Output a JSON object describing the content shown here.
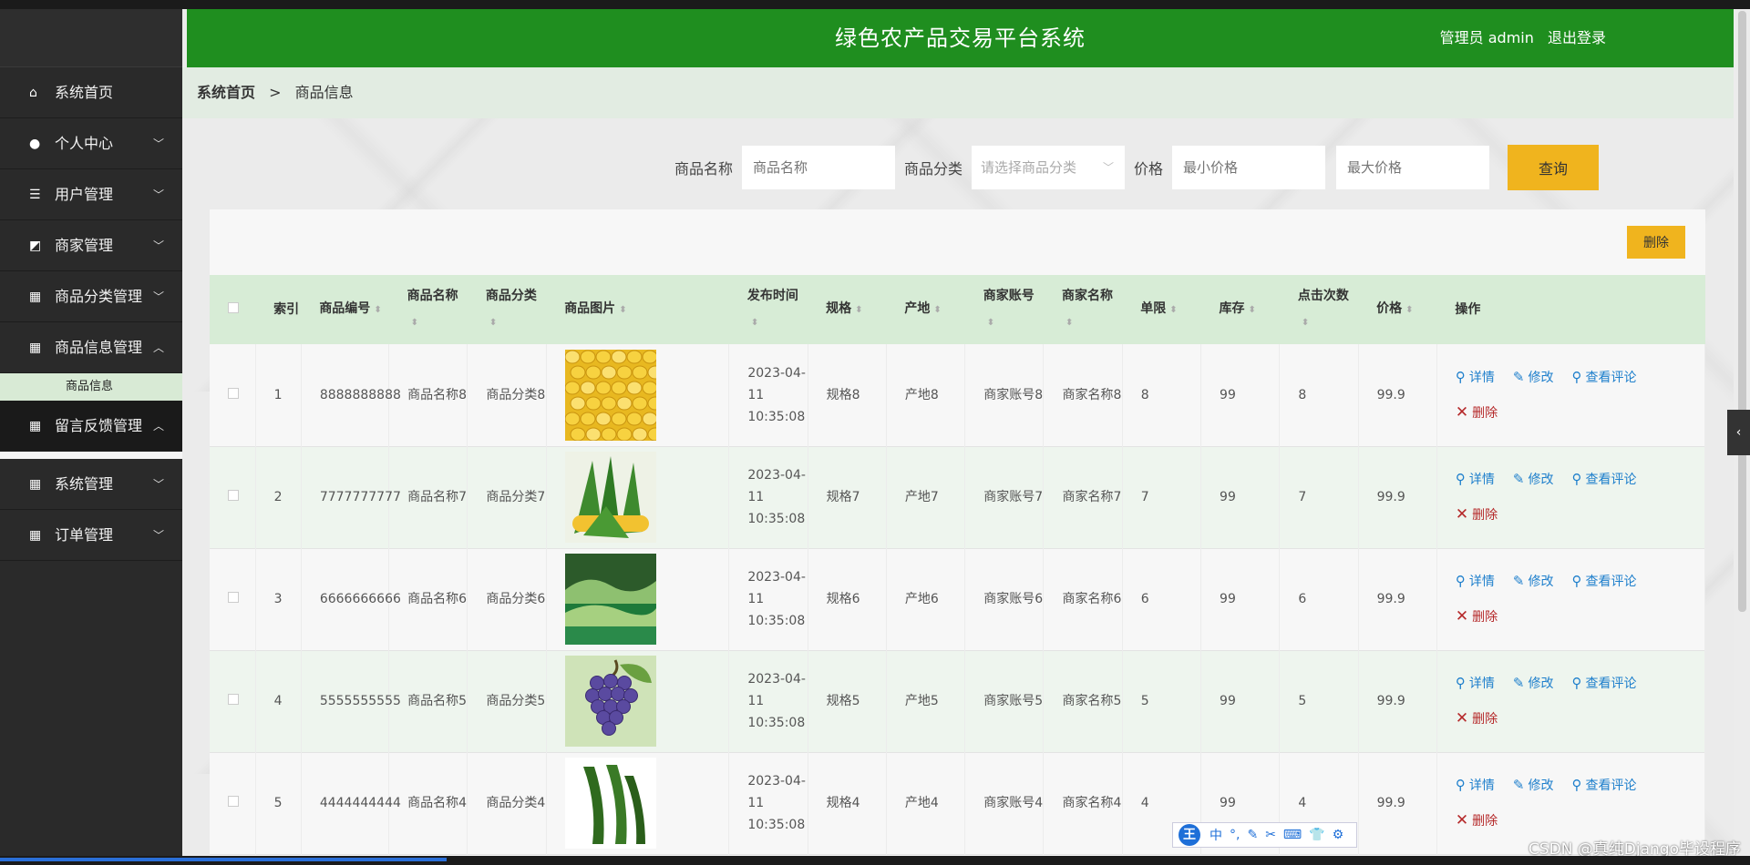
{
  "header": {
    "title": "绿色农产品交易平台系统",
    "user": "管理员 admin",
    "logout": "退出登录"
  },
  "breadcrumb": {
    "home": "系统首页",
    "sep": ">",
    "current": "商品信息"
  },
  "sidebar": {
    "items": [
      {
        "label": "系统首页",
        "icon": "home-icon",
        "glyph": "⌂",
        "arrow": ""
      },
      {
        "label": "个人中心",
        "icon": "user-icon",
        "glyph": "●",
        "arrow": "﹀"
      },
      {
        "label": "用户管理",
        "icon": "list-icon",
        "glyph": "☰",
        "arrow": "﹀"
      },
      {
        "label": "商家管理",
        "icon": "chart-icon",
        "glyph": "◩",
        "arrow": "﹀"
      },
      {
        "label": "商品分类管理",
        "icon": "grid-icon",
        "glyph": "▦",
        "arrow": "﹀"
      },
      {
        "label": "商品信息管理",
        "icon": "grid-icon",
        "glyph": "▦",
        "arrow": "︿"
      }
    ],
    "submenu": "商品信息",
    "items2": [
      {
        "label": "留言反馈管理",
        "icon": "grid-icon",
        "glyph": "▦",
        "arrow": "︿"
      },
      {
        "label": "系统管理",
        "icon": "grid-icon",
        "glyph": "▦",
        "arrow": "﹀"
      },
      {
        "label": "订单管理",
        "icon": "grid-icon",
        "glyph": "▦",
        "arrow": "﹀"
      }
    ]
  },
  "search": {
    "name_label": "商品名称",
    "name_placeholder": "商品名称",
    "category_label": "商品分类",
    "category_placeholder": "请选择商品分类",
    "price_label": "价格",
    "min_placeholder": "最小价格",
    "max_placeholder": "最大价格",
    "query": "查询"
  },
  "toolbar": {
    "delete": "删除"
  },
  "table": {
    "headers": [
      "索引",
      "商品编号",
      "商品名称",
      "商品分类",
      "商品图片",
      "发布时间",
      "规格",
      "产地",
      "商家账号",
      "商家名称",
      "单限",
      "库存",
      "点击次数",
      "价格",
      "操作"
    ],
    "ops": {
      "detail": "详情",
      "edit": "修改",
      "comments": "查看评论",
      "delete": "删除"
    },
    "rows": [
      {
        "idx": "1",
        "code": "8888888888",
        "name": "商品名称8",
        "cat": "商品分类8",
        "image": "corn-kernels",
        "time": "2023-04-11 10:35:08",
        "spec": "规格8",
        "origin": "产地8",
        "acct": "商家账号8",
        "mname": "商家名称8",
        "limit": "8",
        "stock": "99",
        "clicks": "8",
        "price": "99.9"
      },
      {
        "idx": "2",
        "code": "7777777777",
        "name": "商品名称7",
        "cat": "商品分类7",
        "image": "corn-cob",
        "time": "2023-04-11 10:35:08",
        "spec": "规格7",
        "origin": "产地7",
        "acct": "商家账号7",
        "mname": "商家名称7",
        "limit": "7",
        "stock": "99",
        "clicks": "7",
        "price": "99.9"
      },
      {
        "idx": "3",
        "code": "6666666666",
        "name": "商品名称6",
        "cat": "商品分类6",
        "image": "vegetable-crates",
        "time": "2023-04-11 10:35:08",
        "spec": "规格6",
        "origin": "产地6",
        "acct": "商家账号6",
        "mname": "商家名称6",
        "limit": "6",
        "stock": "99",
        "clicks": "6",
        "price": "99.9"
      },
      {
        "idx": "4",
        "code": "5555555555",
        "name": "商品名称5",
        "cat": "商品分类5",
        "image": "grapes",
        "time": "2023-04-11 10:35:08",
        "spec": "规格5",
        "origin": "产地5",
        "acct": "商家账号5",
        "mname": "商家名称5",
        "limit": "5",
        "stock": "99",
        "clicks": "5",
        "price": "99.9"
      },
      {
        "idx": "5",
        "code": "4444444444",
        "name": "商品名称4",
        "cat": "商品分类4",
        "image": "cucumbers",
        "time": "2023-04-11 10:35:08",
        "spec": "规格4",
        "origin": "产地4",
        "acct": "商家账号4",
        "mname": "商家名称4",
        "limit": "4",
        "stock": "99",
        "clicks": "4",
        "price": "99.9"
      }
    ]
  },
  "ime": {
    "chars": [
      "中",
      "°,",
      "✎",
      "✂",
      "⌨",
      "👕",
      "⚙"
    ]
  },
  "watermark": "CSDN @真纯Django毕设程序",
  "colors": {
    "header": "#1f8e1f",
    "accent": "#f0b41e",
    "sidebar": "#2a2a2a",
    "link": "#1e7fcc",
    "danger": "#b5292a"
  }
}
